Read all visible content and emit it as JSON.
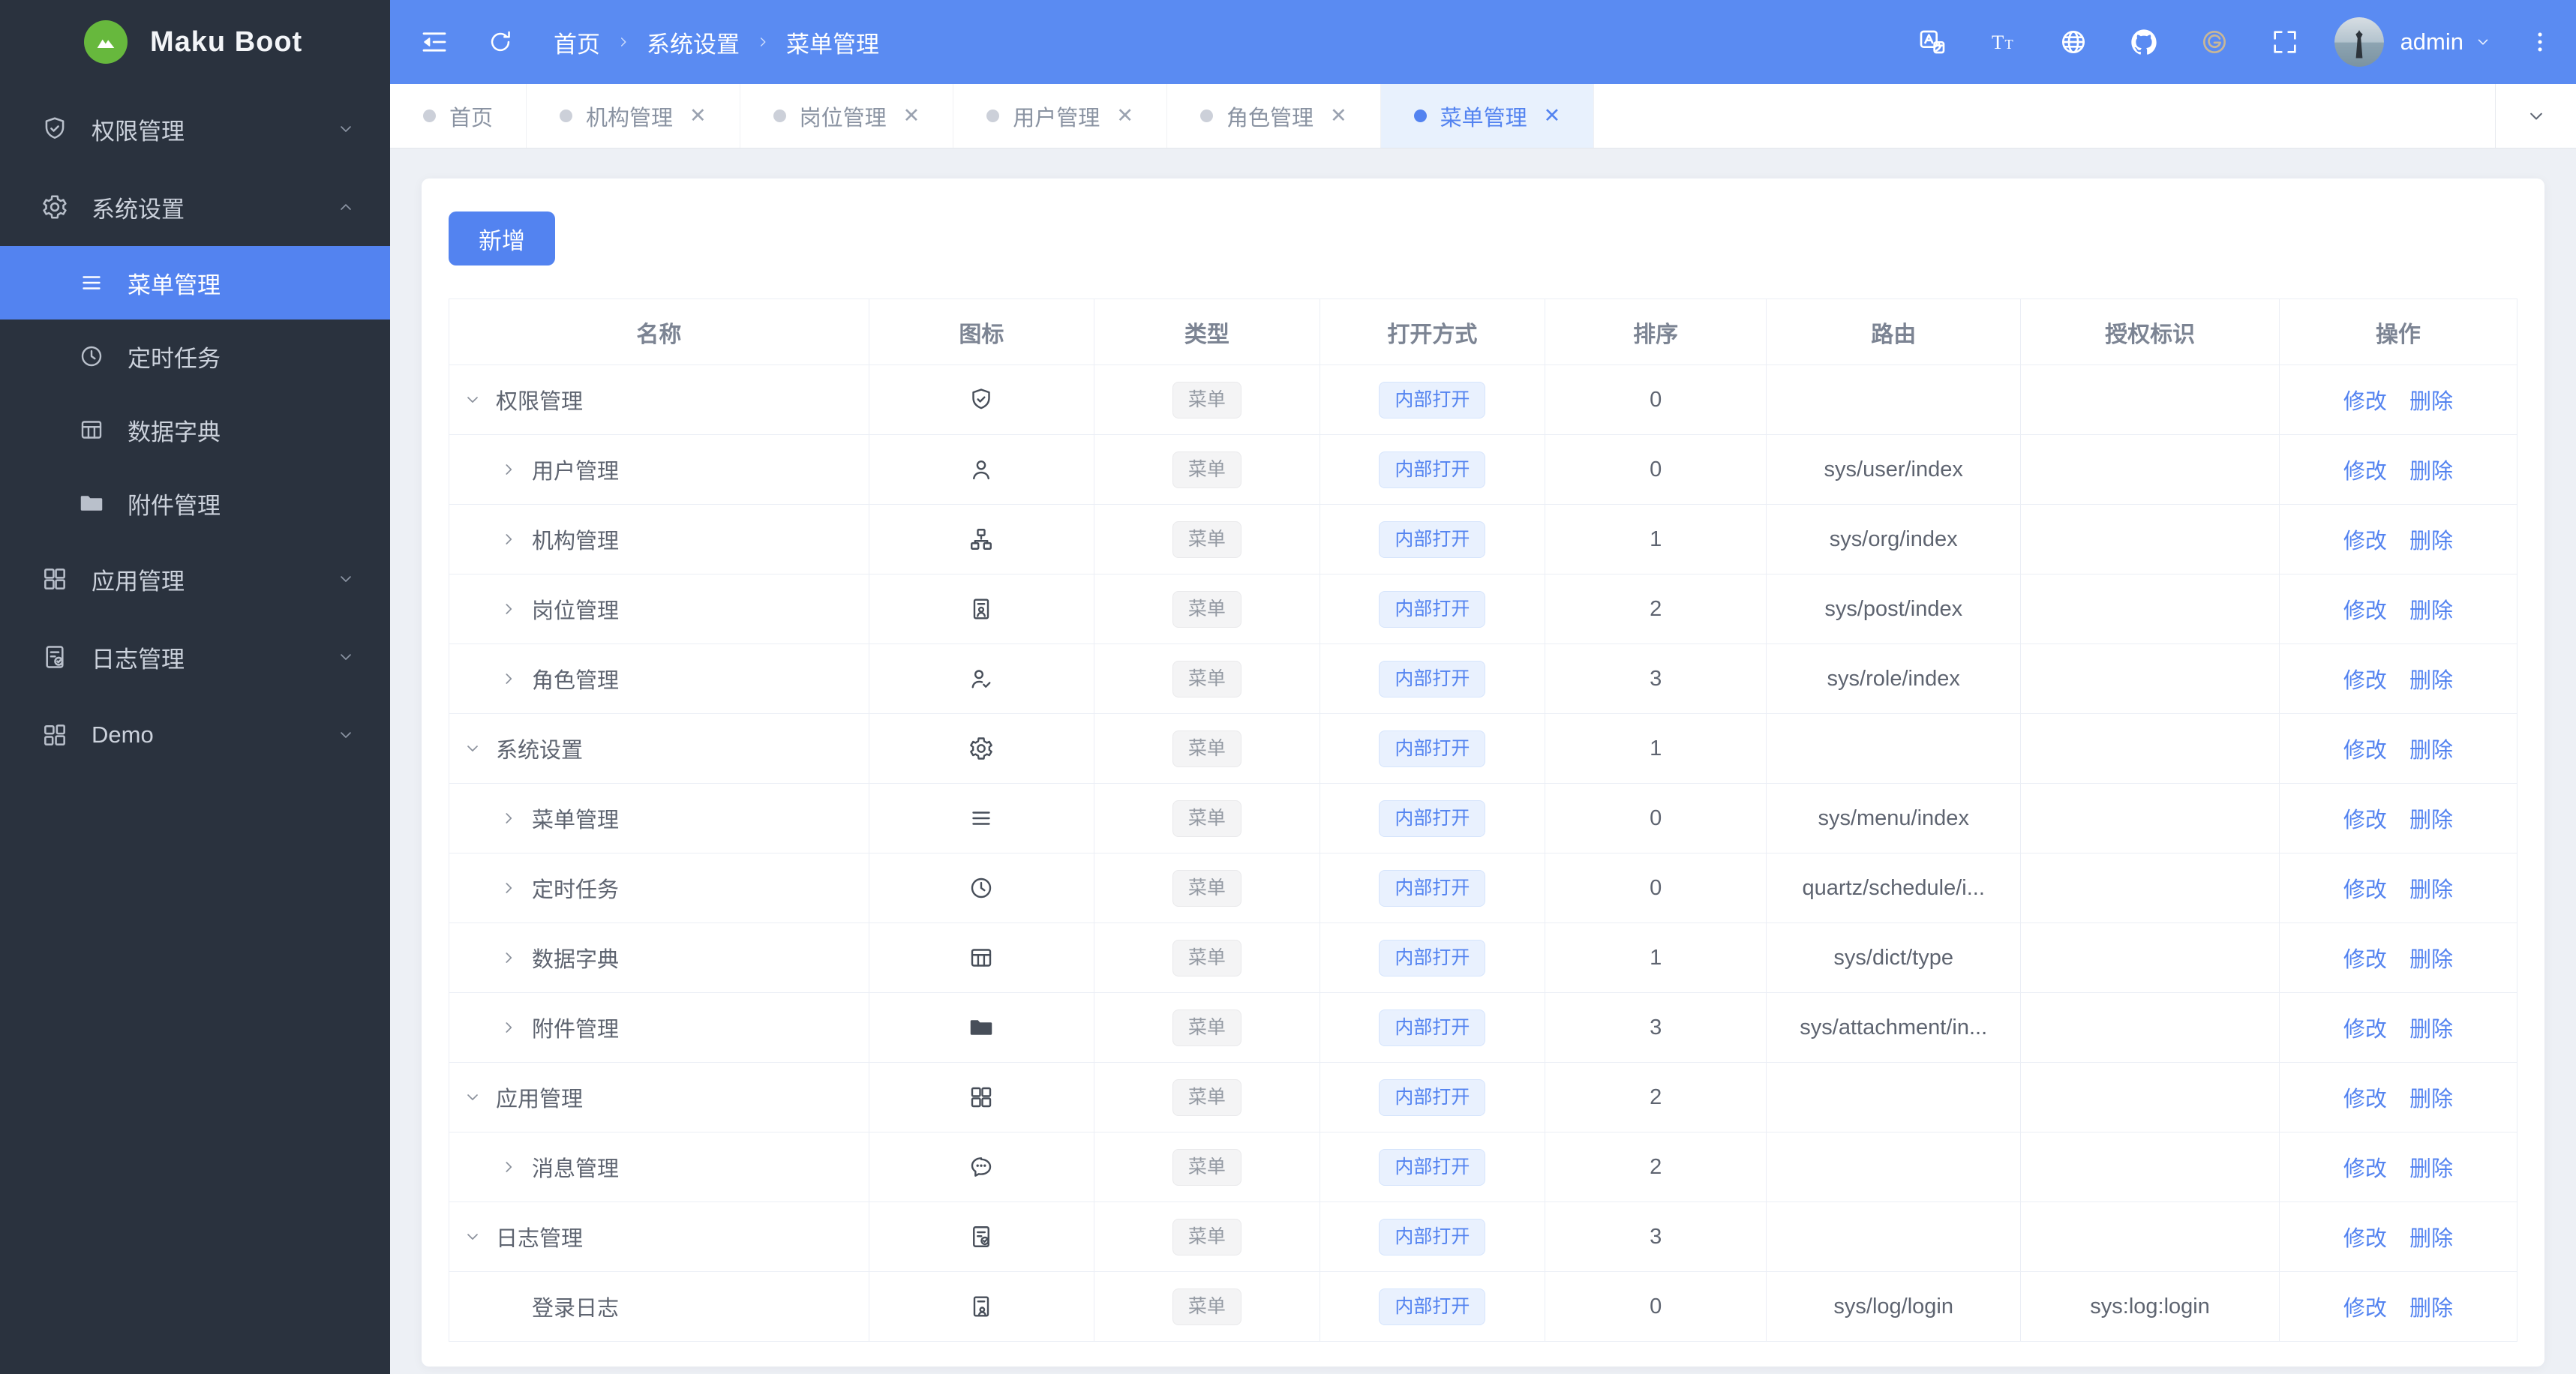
{
  "colors": {
    "primary": "#5383f0",
    "header_bg": "#5a8bf2",
    "sidebar_bg": "#2a323e",
    "page_bg": "#edf0f5",
    "active_tab_bg": "#e8f1fd",
    "logo_green": "#67b83d"
  },
  "brand": {
    "title": "Maku Boot",
    "logo_icon": "mountain"
  },
  "header": {
    "breadcrumb": [
      "首页",
      "系统设置",
      "菜单管理"
    ],
    "actions": [
      {
        "id": "locale",
        "icon": "translate"
      },
      {
        "id": "font-size",
        "icon": "font-size"
      },
      {
        "id": "language",
        "icon": "globe"
      },
      {
        "id": "github",
        "icon": "github"
      },
      {
        "id": "gitee",
        "icon": "gitee",
        "tone": "tan"
      },
      {
        "id": "fullscreen",
        "icon": "fullscreen"
      }
    ],
    "username": "admin"
  },
  "tabs": [
    {
      "id": "home",
      "label": "首页",
      "closable": false,
      "active": false
    },
    {
      "id": "org-management",
      "label": "机构管理",
      "closable": true,
      "active": false
    },
    {
      "id": "post-management",
      "label": "岗位管理",
      "closable": true,
      "active": false
    },
    {
      "id": "user-management",
      "label": "用户管理",
      "closable": true,
      "active": false
    },
    {
      "id": "role-management",
      "label": "角色管理",
      "closable": true,
      "active": false
    },
    {
      "id": "menu-management",
      "label": "菜单管理",
      "closable": true,
      "active": true
    }
  ],
  "sidebar": {
    "items": [
      {
        "id": "permission-management",
        "label": "权限管理",
        "icon": "shield-check",
        "state": "collapsed"
      },
      {
        "id": "system-settings",
        "label": "系统设置",
        "icon": "gear",
        "state": "expanded",
        "children": [
          {
            "id": "menu-management",
            "label": "菜单管理",
            "icon": "menu-lines",
            "active": true
          },
          {
            "id": "scheduled-tasks",
            "label": "定时任务",
            "icon": "clock",
            "active": false
          },
          {
            "id": "data-dictionary",
            "label": "数据字典",
            "icon": "dict-table",
            "active": false
          },
          {
            "id": "attachment-management",
            "label": "附件管理",
            "icon": "folder-filled",
            "active": false
          }
        ]
      },
      {
        "id": "app-management",
        "label": "应用管理",
        "icon": "app-grid",
        "state": "collapsed"
      },
      {
        "id": "log-management",
        "label": "日志管理",
        "icon": "log-doc",
        "state": "collapsed"
      },
      {
        "id": "demo",
        "label": "Demo",
        "icon": "demo-grid",
        "state": "collapsed"
      }
    ]
  },
  "toolbar": {
    "add_label": "新增"
  },
  "table": {
    "columns": [
      "名称",
      "图标",
      "类型",
      "打开方式",
      "排序",
      "路由",
      "授权标识",
      "操作"
    ],
    "type_tag": "菜单",
    "open_tag": "内部打开",
    "actions": [
      "修改",
      "删除"
    ],
    "rows": [
      {
        "name": "权限管理",
        "level": 0,
        "chevron": "down",
        "icon": "shield-check",
        "sort": "0",
        "route": "",
        "perm": ""
      },
      {
        "name": "用户管理",
        "level": 1,
        "chevron": "right",
        "icon": "user",
        "sort": "0",
        "route": "sys/user/index",
        "perm": ""
      },
      {
        "name": "机构管理",
        "level": 1,
        "chevron": "right",
        "icon": "org",
        "sort": "1",
        "route": "sys/org/index",
        "perm": ""
      },
      {
        "name": "岗位管理",
        "level": 1,
        "chevron": "right",
        "icon": "post",
        "sort": "2",
        "route": "sys/post/index",
        "perm": ""
      },
      {
        "name": "角色管理",
        "level": 1,
        "chevron": "right",
        "icon": "role",
        "sort": "3",
        "route": "sys/role/index",
        "perm": ""
      },
      {
        "name": "系统设置",
        "level": 0,
        "chevron": "down",
        "icon": "gear",
        "sort": "1",
        "route": "",
        "perm": ""
      },
      {
        "name": "菜单管理",
        "level": 1,
        "chevron": "right",
        "icon": "menu-lines",
        "sort": "0",
        "route": "sys/menu/index",
        "perm": ""
      },
      {
        "name": "定时任务",
        "level": 1,
        "chevron": "right",
        "icon": "clock",
        "sort": "0",
        "route": "quartz/schedule/i...",
        "perm": ""
      },
      {
        "name": "数据字典",
        "level": 1,
        "chevron": "right",
        "icon": "dict-table",
        "sort": "1",
        "route": "sys/dict/type",
        "perm": ""
      },
      {
        "name": "附件管理",
        "level": 1,
        "chevron": "right",
        "icon": "folder-filled",
        "sort": "3",
        "route": "sys/attachment/in...",
        "perm": ""
      },
      {
        "name": "应用管理",
        "level": 0,
        "chevron": "down",
        "icon": "app-grid",
        "sort": "2",
        "route": "",
        "perm": ""
      },
      {
        "name": "消息管理",
        "level": 1,
        "chevron": "right",
        "icon": "message",
        "sort": "2",
        "route": "",
        "perm": ""
      },
      {
        "name": "日志管理",
        "level": 0,
        "chevron": "down",
        "icon": "log-doc",
        "sort": "3",
        "route": "",
        "perm": ""
      },
      {
        "name": "登录日志",
        "level": 1,
        "chevron": "none",
        "icon": "login-log",
        "sort": "0",
        "route": "sys/log/login",
        "perm": "sys:log:login"
      }
    ]
  }
}
